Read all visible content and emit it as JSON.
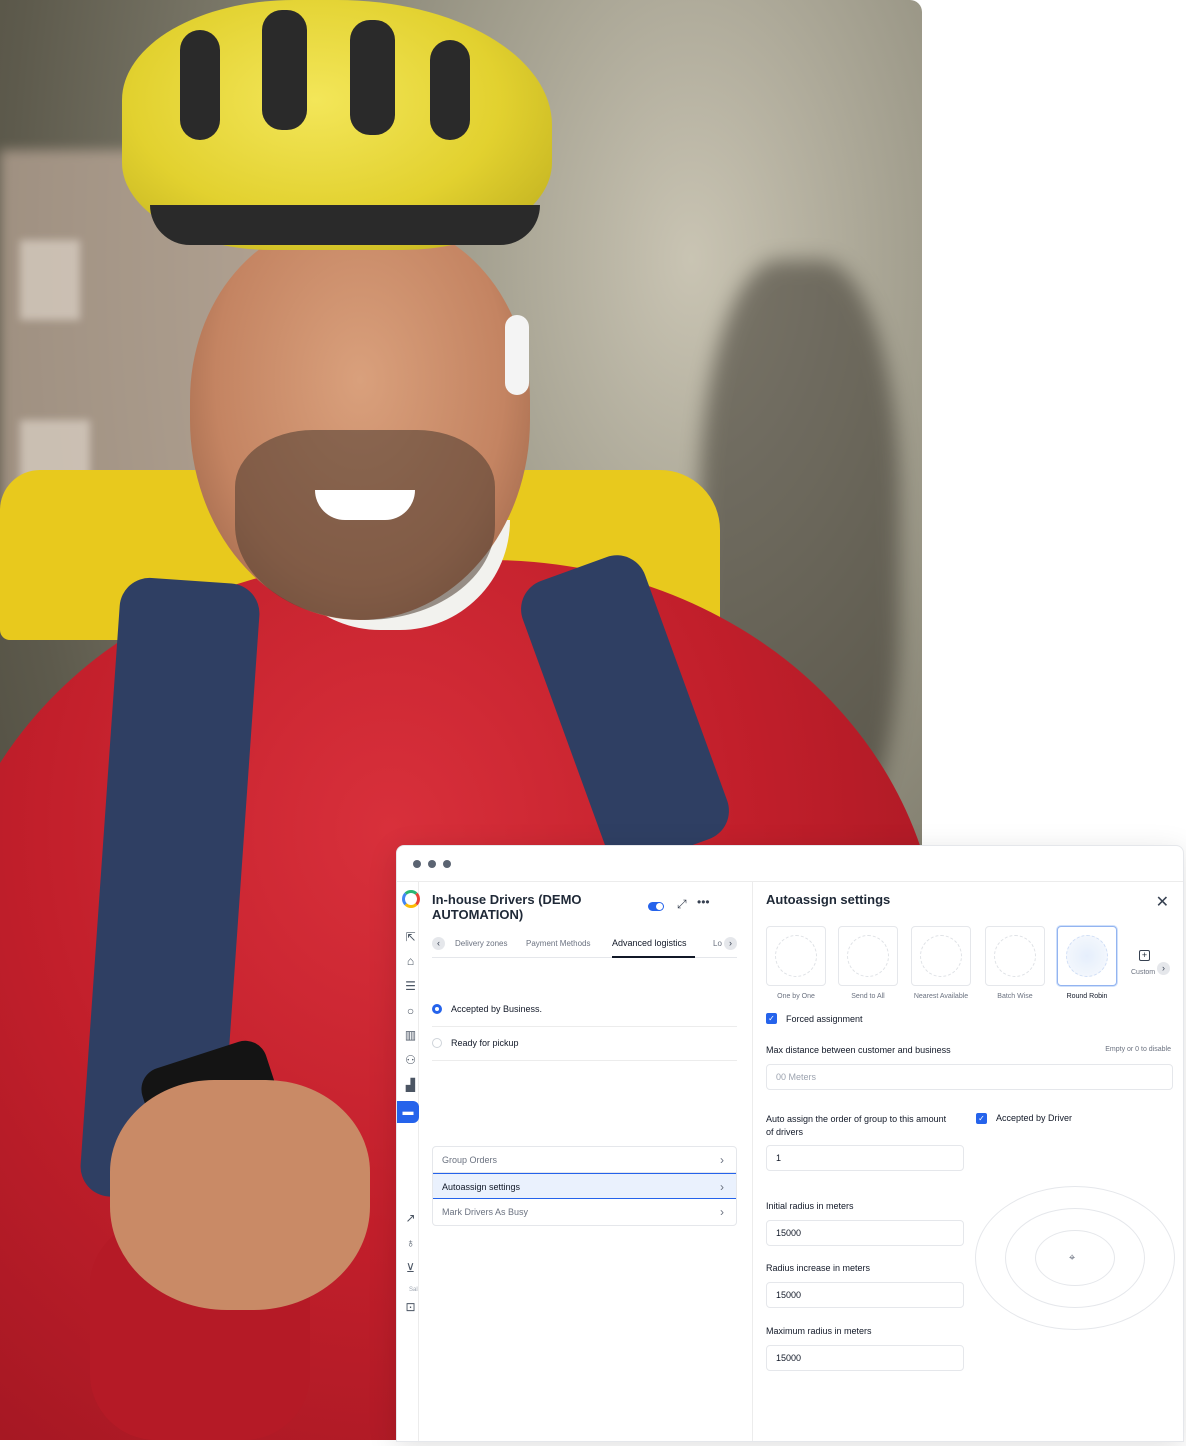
{
  "window": {
    "title_line1": "In-house Drivers (DEMO",
    "title_line2": "AUTOMATION)",
    "tabs": [
      "Delivery zones",
      "Payment Methods",
      "Advanced logistics",
      "Lo"
    ],
    "active_tab": "Advanced logistics",
    "radio_options": [
      {
        "label": "Accepted by Business.",
        "selected": true
      },
      {
        "label": "Ready for pickup",
        "selected": false
      }
    ],
    "menu": [
      {
        "label": "Group Orders",
        "active": false
      },
      {
        "label": "Autoassign settings",
        "active": true
      },
      {
        "label": "Mark Drivers As Busy",
        "active": false
      }
    ],
    "rail_small_text": "Sal"
  },
  "autoassign": {
    "title": "Autoassign settings",
    "strategies": [
      "One by One",
      "Send to All",
      "Nearest Available",
      "Batch Wise",
      "Round Robin",
      "Custom"
    ],
    "selected_strategy": "Round Robin",
    "forced_assignment": {
      "label": "Forced assignment",
      "checked": true
    },
    "max_distance": {
      "label": "Max distance between customer and business",
      "hint": "Empty or 0 to disable",
      "placeholder": "00 Meters"
    },
    "group_order": {
      "label_line1": "Auto assign the order of group to this amount",
      "label_line2": "of drivers",
      "value": "1"
    },
    "accepted_by_driver": {
      "label": "Accepted by Driver",
      "checked": true
    },
    "initial_radius": {
      "label": "Initial radius in meters",
      "value": "15000"
    },
    "radius_increase": {
      "label": "Radius increase in meters",
      "value": "15000"
    },
    "maximum_radius": {
      "label": "Maximum radius in meters",
      "value": "15000"
    }
  },
  "colors": {
    "accent": "#2563eb",
    "active_row_bg": "#eaf1fd",
    "helmet": "#e2d12f",
    "sweater": "#c21f2b"
  },
  "icons": {
    "rail": [
      "external-link-icon",
      "home-icon",
      "list-icon",
      "chat-icon",
      "store-icon",
      "users-icon",
      "bar-chart-icon",
      "truck-icon",
      "line-chart-icon",
      "lightbulb-icon",
      "cart-icon",
      "bag-icon"
    ]
  }
}
